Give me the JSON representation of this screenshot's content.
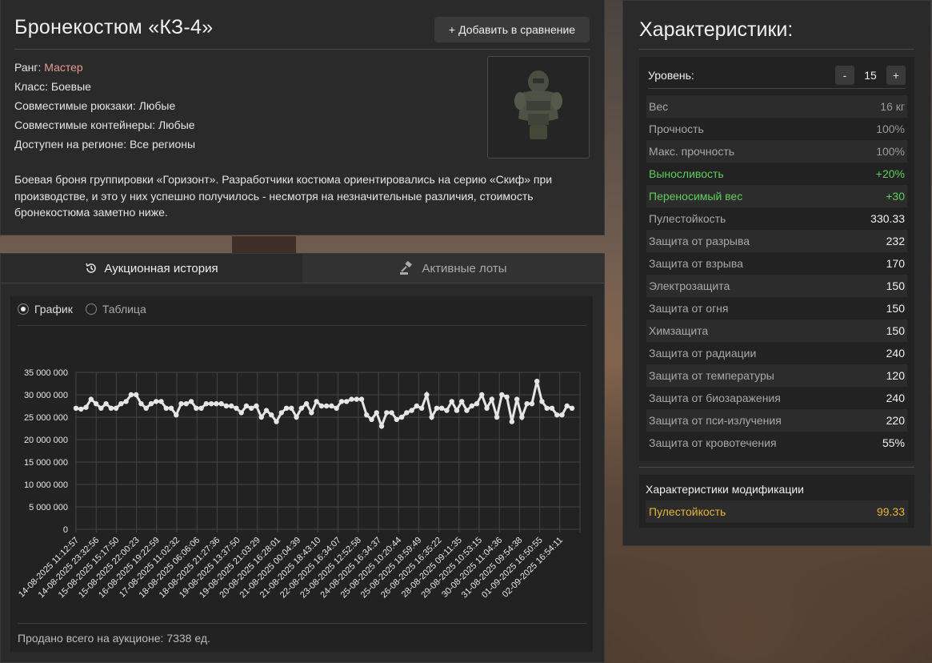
{
  "item": {
    "title": "Бронекостюм «КЗ-4»",
    "compare_button": "Добавить в сравнение",
    "rank_label": "Ранг: ",
    "rank_value": "Мастер",
    "class_line": "Класс: Боевые",
    "backpacks_line": "Совместимые рюкзаки: Любые",
    "containers_line": "Совместимые контейнеры: Любые",
    "region_line": "Доступен на регионе: Все регионы",
    "description": "Боевая броня группировки «Горизонт». Разработчики костюма ориентировались на серию «Скиф» при производстве, и это у них успешно получилось - несмотря на незначительные различия, стоимость бронекостюма заметно ниже."
  },
  "tabs": {
    "history": "Аукционная история",
    "lots": "Активные лоты"
  },
  "view": {
    "chart_option": "График",
    "table_option": "Таблица"
  },
  "footer": "Продано всего на аукционе: 7338 ед.",
  "stats": {
    "title": "Характеристики:",
    "level_label": "Уровень:",
    "level_value": "15",
    "minus": "-",
    "plus": "+",
    "rows": [
      {
        "label": "Вес",
        "value": "16 кг"
      },
      {
        "label": "Прочность",
        "value": "100%"
      },
      {
        "label": "Макс. прочность",
        "value": "100%"
      },
      {
        "label": "Выносливость",
        "value": "+20%"
      },
      {
        "label": "Переносимый вес",
        "value": "+30"
      },
      {
        "label": "Пулестойкость",
        "value": "330.33"
      },
      {
        "label": "Защита от разрыва",
        "value": "232"
      },
      {
        "label": "Защита от взрыва",
        "value": "170"
      },
      {
        "label": "Электрозащита",
        "value": "150"
      },
      {
        "label": "Защита от огня",
        "value": "150"
      },
      {
        "label": "Химзащита",
        "value": "150"
      },
      {
        "label": "Защита от радиации",
        "value": "240"
      },
      {
        "label": "Защита от температуры",
        "value": "120"
      },
      {
        "label": "Защита от биозаражения",
        "value": "240"
      },
      {
        "label": "Защита от пси-излучения",
        "value": "220"
      },
      {
        "label": "Защита от кровотечения",
        "value": "55%"
      }
    ],
    "mod_title": "Характеристики модификации",
    "mod_label": "Пулестойкость",
    "mod_value": "99.33"
  },
  "colors": {
    "rank": "#e79a8f",
    "positive": "#5fcf5c",
    "modification": "#e8b53a",
    "series": "#e6e6e6"
  },
  "chart_data": {
    "type": "line",
    "ylim": [
      0,
      35000000
    ],
    "yticks": [
      "35 000 000",
      "30 000 000",
      "25 000 000",
      "20 000 000",
      "15 000 000",
      "10 000 000",
      "5 000 000",
      "0"
    ],
    "xticks": [
      "14-08-2025 11:12:57",
      "14-08-2025 23:32:56",
      "15-08-2025 15:17:50",
      "15-08-2025 22:00:23",
      "16-08-2025 19:22:59",
      "17-08-2025 11:02:32",
      "18-08-2025 06:06:06",
      "18-08-2025 21:27:36",
      "19-08-2025 13:37:50",
      "19-08-2025 21:03:29",
      "20-08-2025 16:28:01",
      "21-08-2025 00:04:39",
      "21-08-2025 18:43:10",
      "22-08-2025 16:34:07",
      "23-08-2025 12:52:58",
      "24-08-2025 16:34:37",
      "25-08-2025 10:20:44",
      "25-08-2025 18:59:49",
      "26-08-2025 16:35:22",
      "28-08-2025 09:11:35",
      "29-08-2025 10:53:15",
      "30-08-2025 11:04:36",
      "31-08-2025 09:54:38",
      "01-09-2025 16:50:55",
      "02-09-2025 16:54:11"
    ],
    "grid": true,
    "values": [
      27000000,
      26800000,
      27200000,
      29000000,
      28000000,
      27000000,
      28000000,
      27000000,
      27000000,
      28000000,
      28500000,
      30000000,
      30000000,
      28000000,
      27000000,
      28000000,
      28500000,
      28500000,
      27000000,
      27000000,
      25500000,
      28000000,
      28000000,
      28500000,
      27000000,
      27000000,
      28000000,
      28000000,
      28000000,
      28000000,
      27500000,
      27500000,
      27000000,
      26000000,
      27500000,
      27000000,
      27500000,
      25000000,
      26500000,
      25500000,
      24000000,
      26000000,
      27000000,
      27000000,
      25000000,
      27000000,
      28000000,
      26000000,
      28500000,
      27500000,
      27500000,
      27500000,
      27000000,
      28500000,
      28500000,
      29000000,
      29000000,
      29000000,
      25500000,
      24500000,
      26000000,
      23000000,
      26000000,
      26000000,
      24500000,
      25000000,
      26000000,
      26500000,
      27500000,
      27000000,
      30000000,
      25000000,
      27000000,
      27000000,
      26500000,
      28500000,
      26500000,
      28500000,
      26500000,
      27500000,
      28000000,
      30000000,
      27000000,
      29000000,
      25000000,
      30000000,
      29500000,
      24000000,
      29000000,
      25000000,
      28000000,
      28000000,
      33000000,
      28500000,
      27000000,
      27000000,
      25500000,
      25500000,
      27500000,
      27000000
    ]
  }
}
